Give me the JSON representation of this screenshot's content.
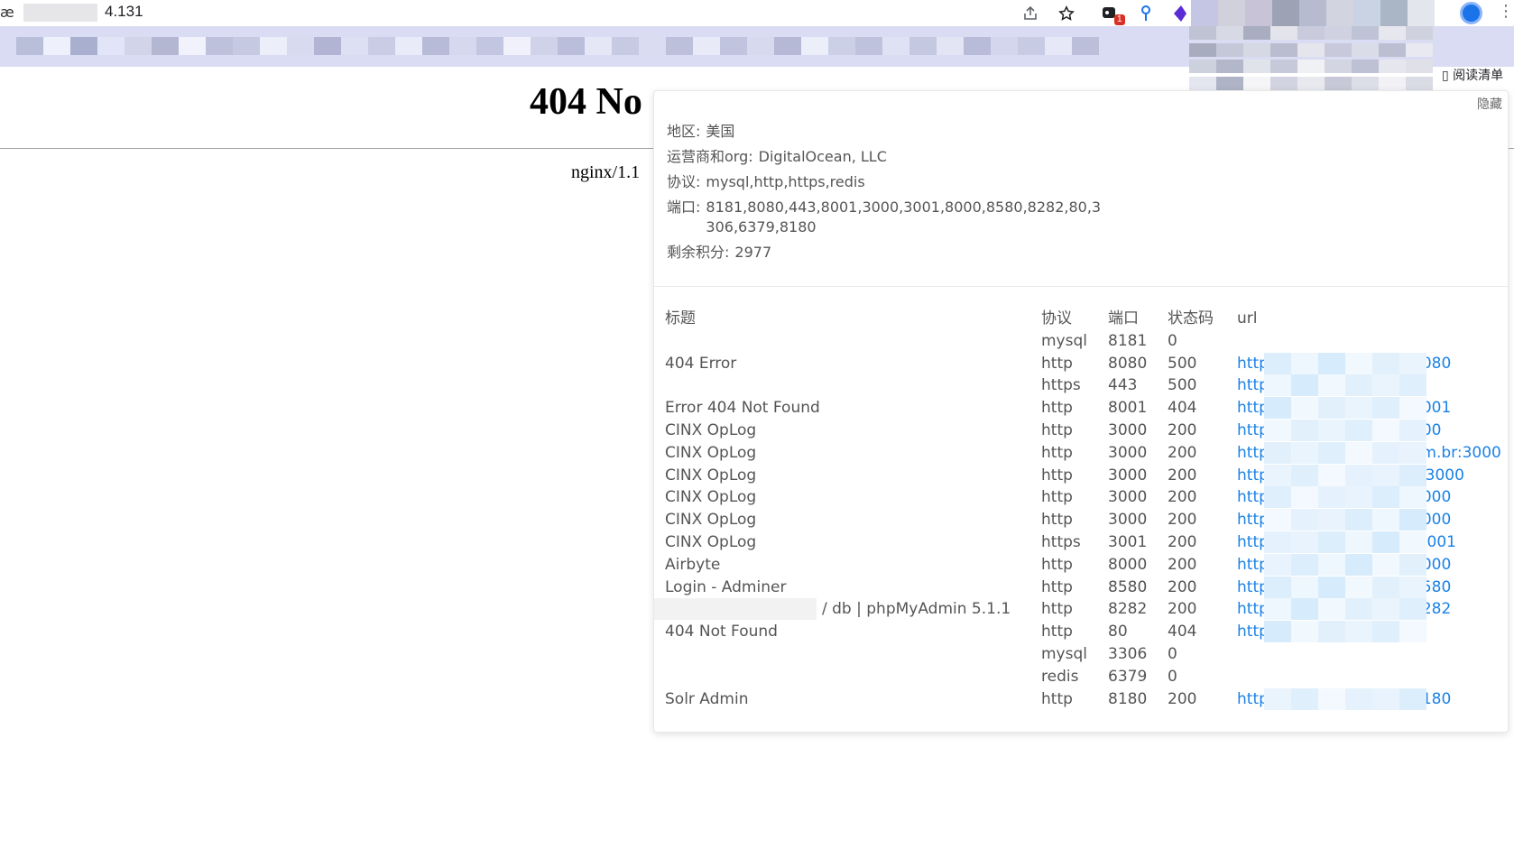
{
  "browser": {
    "address_visible": "4.131",
    "address_edge": "æ",
    "extension_badge": "1",
    "reading_list": "阅读清单"
  },
  "page": {
    "heading_visible": "404 No",
    "server_visible": "nginx/1.1"
  },
  "panel": {
    "hide_label": "隐藏",
    "info": {
      "region_label": "地区:",
      "region_value": "美国",
      "org_label": "运营商和org:",
      "org_value": "DigitalOcean, LLC",
      "protocol_label": "协议:",
      "protocol_value": "mysql,http,https,redis",
      "ports_label": "端口:",
      "ports_value": "8181,8080,443,8001,3000,3001,8000,8580,8282,80,3306,6379,8180",
      "points_label": "剩余积分:",
      "points_value": "2977"
    },
    "table": {
      "headers": {
        "title": "标题",
        "protocol": "协议",
        "port": "端口",
        "status": "状态码",
        "url": "url"
      },
      "rows": [
        {
          "title": "",
          "protocol": "mysql",
          "port": "8181",
          "status": "0",
          "url_prefix": "",
          "url_suffix": ""
        },
        {
          "title": "404 Error",
          "protocol": "http",
          "port": "8080",
          "status": "500",
          "url_prefix": "http",
          "url_suffix": "8080"
        },
        {
          "title": "",
          "protocol": "https",
          "port": "443",
          "status": "500",
          "url_prefix": "http",
          "url_suffix": ""
        },
        {
          "title": "Error 404 Not Found",
          "protocol": "http",
          "port": "8001",
          "status": "404",
          "url_prefix": "http",
          "url_suffix": "3001"
        },
        {
          "title": "CINX OpLog",
          "protocol": "http",
          "port": "3000",
          "status": "200",
          "url_prefix": "http",
          "url_suffix": "000"
        },
        {
          "title": "CINX OpLog",
          "protocol": "http",
          "port": "3000",
          "status": "200",
          "url_prefix": "http",
          "url_suffix": "om.br:3000"
        },
        {
          "title": "CINX OpLog",
          "protocol": "http",
          "port": "3000",
          "status": "200",
          "url_prefix": "http",
          "url_suffix": "z:3000"
        },
        {
          "title": "CINX OpLog",
          "protocol": "http",
          "port": "3000",
          "status": "200",
          "url_prefix": "http",
          "url_suffix": "3000"
        },
        {
          "title": "CINX OpLog",
          "protocol": "http",
          "port": "3000",
          "status": "200",
          "url_prefix": "http",
          "url_suffix": "3000"
        },
        {
          "title": "CINX OpLog",
          "protocol": "https",
          "port": "3001",
          "status": "200",
          "url_prefix": "http",
          "url_suffix": ":3001"
        },
        {
          "title": "Airbyte",
          "protocol": "http",
          "port": "8000",
          "status": "200",
          "url_prefix": "http",
          "url_suffix": "3000"
        },
        {
          "title": "Login - Adminer",
          "protocol": "http",
          "port": "8580",
          "status": "200",
          "url_prefix": "http",
          "url_suffix": "3580"
        },
        {
          "title": "/ db | phpMyAdmin 5.1.1",
          "protocol": "http",
          "port": "8282",
          "status": "200",
          "url_prefix": "http",
          "url_suffix": "3282"
        },
        {
          "title": "404 Not Found",
          "protocol": "http",
          "port": "80",
          "status": "404",
          "url_prefix": "http",
          "url_suffix": ""
        },
        {
          "title": "",
          "protocol": "mysql",
          "port": "3306",
          "status": "0",
          "url_prefix": "",
          "url_suffix": ""
        },
        {
          "title": "",
          "protocol": "redis",
          "port": "6379",
          "status": "0",
          "url_prefix": "",
          "url_suffix": ""
        },
        {
          "title": "Solr Admin",
          "protocol": "http",
          "port": "8180",
          "status": "200",
          "url_prefix": "http",
          "url_suffix": "3180"
        }
      ]
    }
  },
  "colors": {
    "link": "#1a82e6",
    "bookmark_bar": "#dadcf3",
    "badge": "#d93025"
  },
  "icons": {
    "share": "share-icon",
    "star": "star-icon",
    "extension_1": "extension-icon",
    "extension_2": "pin-icon",
    "extension_3": "purple-extension-icon",
    "profile": "profile-icon",
    "menu": "kebab-menu-icon",
    "reading_list": "reading-list-icon"
  }
}
